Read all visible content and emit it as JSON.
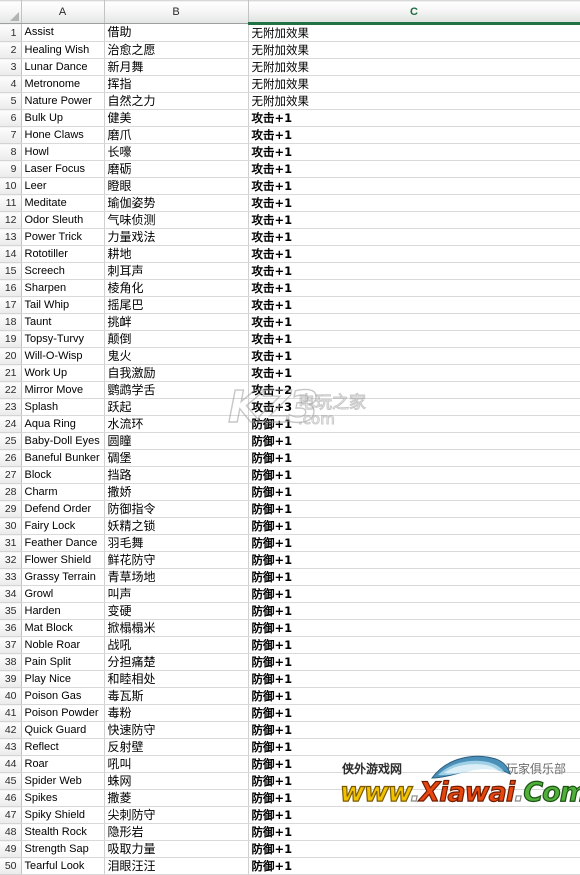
{
  "app": {
    "type": "spreadsheet",
    "select_all_corner": "select-all"
  },
  "columns": {
    "row_header_label": "",
    "headers": [
      "A",
      "B",
      "C"
    ],
    "selected_column": "C",
    "selection_color": "#217346"
  },
  "table": {
    "column_headers": [
      "A",
      "B",
      "C"
    ],
    "rows": [
      {
        "n": "1",
        "a": "Assist",
        "b": "借助",
        "c": "无附加效果"
      },
      {
        "n": "2",
        "a": "Healing Wish",
        "b": "治愈之愿",
        "c": "无附加效果"
      },
      {
        "n": "3",
        "a": "Lunar Dance",
        "b": "新月舞",
        "c": "无附加效果"
      },
      {
        "n": "4",
        "a": "Metronome",
        "b": "挥指",
        "c": "无附加效果"
      },
      {
        "n": "5",
        "a": "Nature Power",
        "b": "自然之力",
        "c": "无附加效果"
      },
      {
        "n": "6",
        "a": "Bulk Up",
        "b": "健美",
        "c": "攻击+1"
      },
      {
        "n": "7",
        "a": "Hone Claws",
        "b": "磨爪",
        "c": "攻击+1"
      },
      {
        "n": "8",
        "a": "Howl",
        "b": "长嚎",
        "c": "攻击+1"
      },
      {
        "n": "9",
        "a": "Laser Focus",
        "b": "磨砺",
        "c": "攻击+1"
      },
      {
        "n": "10",
        "a": "Leer",
        "b": "瞪眼",
        "c": "攻击+1"
      },
      {
        "n": "11",
        "a": "Meditate",
        "b": "瑜伽姿势",
        "c": "攻击+1"
      },
      {
        "n": "12",
        "a": "Odor Sleuth",
        "b": "气味侦测",
        "c": "攻击+1"
      },
      {
        "n": "13",
        "a": "Power Trick",
        "b": "力量戏法",
        "c": "攻击+1"
      },
      {
        "n": "14",
        "a": "Rototiller",
        "b": "耕地",
        "c": "攻击+1"
      },
      {
        "n": "15",
        "a": "Screech",
        "b": "刺耳声",
        "c": "攻击+1"
      },
      {
        "n": "16",
        "a": "Sharpen",
        "b": "棱角化",
        "c": "攻击+1"
      },
      {
        "n": "17",
        "a": "Tail Whip",
        "b": "摇尾巴",
        "c": "攻击+1"
      },
      {
        "n": "18",
        "a": "Taunt",
        "b": "挑衅",
        "c": "攻击+1"
      },
      {
        "n": "19",
        "a": "Topsy-Turvy",
        "b": "颠倒",
        "c": "攻击+1"
      },
      {
        "n": "20",
        "a": "Will-O-Wisp",
        "b": "鬼火",
        "c": "攻击+1"
      },
      {
        "n": "21",
        "a": "Work Up",
        "b": "自我激励",
        "c": "攻击+1"
      },
      {
        "n": "22",
        "a": "Mirror Move",
        "b": "鹦鹉学舌",
        "c": "攻击+2"
      },
      {
        "n": "23",
        "a": "Splash",
        "b": "跃起",
        "c": "攻击+3"
      },
      {
        "n": "24",
        "a": "Aqua Ring",
        "b": "水流环",
        "c": "防御+1"
      },
      {
        "n": "25",
        "a": "Baby-Doll Eyes",
        "b": "圆瞳",
        "c": "防御+1"
      },
      {
        "n": "26",
        "a": "Baneful Bunker",
        "b": "碉堡",
        "c": "防御+1"
      },
      {
        "n": "27",
        "a": "Block",
        "b": "挡路",
        "c": "防御+1"
      },
      {
        "n": "28",
        "a": "Charm",
        "b": "撒娇",
        "c": "防御+1"
      },
      {
        "n": "29",
        "a": "Defend Order",
        "b": "防御指令",
        "c": "防御+1"
      },
      {
        "n": "30",
        "a": "Fairy Lock",
        "b": "妖精之锁",
        "c": "防御+1"
      },
      {
        "n": "31",
        "a": "Feather Dance",
        "b": "羽毛舞",
        "c": "防御+1"
      },
      {
        "n": "32",
        "a": "Flower Shield",
        "b": "鲜花防守",
        "c": "防御+1"
      },
      {
        "n": "33",
        "a": "Grassy Terrain",
        "b": "青草场地",
        "c": "防御+1"
      },
      {
        "n": "34",
        "a": "Growl",
        "b": "叫声",
        "c": "防御+1"
      },
      {
        "n": "35",
        "a": "Harden",
        "b": "变硬",
        "c": "防御+1"
      },
      {
        "n": "36",
        "a": "Mat Block",
        "b": "掀榻榻米",
        "c": "防御+1"
      },
      {
        "n": "37",
        "a": "Noble Roar",
        "b": "战吼",
        "c": "防御+1"
      },
      {
        "n": "38",
        "a": "Pain Split",
        "b": "分担痛楚",
        "c": "防御+1"
      },
      {
        "n": "39",
        "a": "Play Nice",
        "b": "和睦相处",
        "c": "防御+1"
      },
      {
        "n": "40",
        "a": "Poison Gas",
        "b": "毒瓦斯",
        "c": "防御+1"
      },
      {
        "n": "41",
        "a": "Poison Powder",
        "b": "毒粉",
        "c": "防御+1"
      },
      {
        "n": "42",
        "a": "Quick Guard",
        "b": "快速防守",
        "c": "防御+1"
      },
      {
        "n": "43",
        "a": "Reflect",
        "b": "反射壁",
        "c": "防御+1"
      },
      {
        "n": "44",
        "a": "Roar",
        "b": "吼叫",
        "c": "防御+1"
      },
      {
        "n": "45",
        "a": "Spider Web",
        "b": "蛛网",
        "c": "防御+1"
      },
      {
        "n": "46",
        "a": "Spikes",
        "b": "撒菱",
        "c": "防御+1"
      },
      {
        "n": "47",
        "a": "Spiky Shield",
        "b": "尖刺防守",
        "c": "防御+1"
      },
      {
        "n": "48",
        "a": "Stealth Rock",
        "b": "隐形岩",
        "c": "防御+1"
      },
      {
        "n": "49",
        "a": "Strength Sap",
        "b": "吸取力量",
        "c": "防御+1"
      },
      {
        "n": "50",
        "a": "Tearful Look",
        "b": "泪眼汪汪",
        "c": "防御+1"
      }
    ]
  },
  "watermarks": {
    "center": {
      "logo": "KZ3",
      "site_cn": "电玩之家",
      "domain": ".com"
    },
    "bottom": {
      "left_cn": "侠外游戏网",
      "right_cn": "玩家俱乐部",
      "url_parts": [
        "www",
        ".",
        "Xiawai",
        ".",
        "Com"
      ],
      "url_full": "www.Xiawai.Com"
    }
  }
}
